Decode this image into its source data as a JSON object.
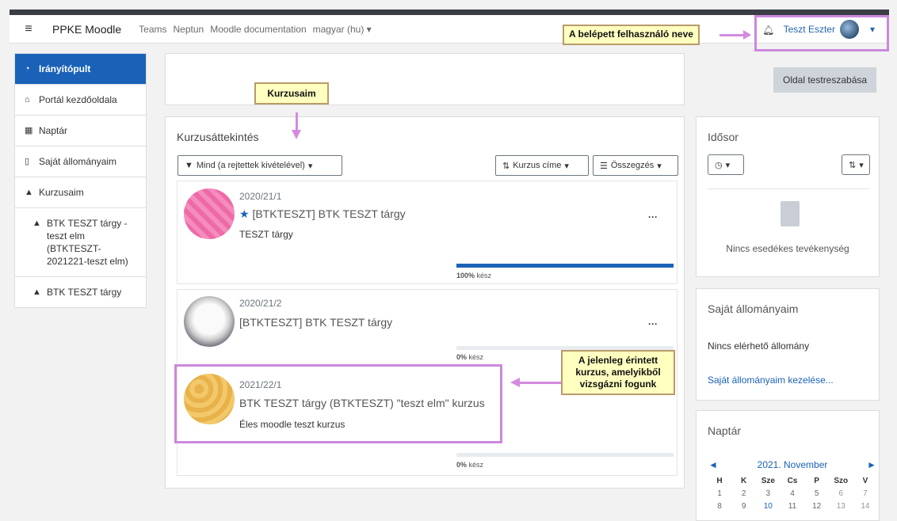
{
  "navbar": {
    "brand": "PPKE Moodle",
    "links": [
      "Teams",
      "Neptun",
      "Moodle documentation",
      "magyar (hu)"
    ],
    "user_name": "Teszt Eszter"
  },
  "sidebar": {
    "items": [
      {
        "label": "Irányítópult",
        "icon": "dashboard-icon"
      },
      {
        "label": "Portál kezdőoldala",
        "icon": "home-icon"
      },
      {
        "label": "Naptár",
        "icon": "calendar-icon"
      },
      {
        "label": "Saját állományaim",
        "icon": "file-icon"
      },
      {
        "label": "Kurzusaim",
        "icon": "graduation-cap-icon"
      },
      {
        "label": "BTK TESZT tárgy - teszt elm (BTKTESZT-2021221-teszt elm)",
        "icon": "graduation-cap-icon"
      },
      {
        "label": "BTK TESZT tárgy",
        "icon": "graduation-cap-icon"
      }
    ]
  },
  "header": {
    "customize_label": "Oldal testreszabása"
  },
  "overview": {
    "title": "Kurzusáttekintés",
    "filter_label": "Mind (a rejtettek kivételével)",
    "sort_label": "Kurzus címe",
    "view_label": "Összegzés",
    "courses": [
      {
        "date": "2020/21/1",
        "title": "[BTKTESZT] BTK TESZT tárgy",
        "subtitle": "TESZT tárgy",
        "progress": 100,
        "progress_num": "100%",
        "progress_suffix": " kész",
        "starred": true
      },
      {
        "date": "2020/21/2",
        "title": "[BTKTESZT] BTK TESZT tárgy",
        "subtitle": "",
        "progress": 0,
        "progress_num": "0%",
        "progress_suffix": " kész",
        "starred": false
      },
      {
        "date": "2021/22/1",
        "title": "BTK TESZT tárgy (BTKTESZT) \"teszt elm\" kurzus",
        "subtitle": "Éles moodle teszt kurzus",
        "progress": 0,
        "progress_num": "0%",
        "progress_suffix": " kész",
        "starred": false
      }
    ]
  },
  "timeline": {
    "title": "Idősor",
    "empty_text": "Nincs esedékes tevékenység"
  },
  "files": {
    "title": "Saját állományaim",
    "empty_text": "Nincs elérhető állomány",
    "manage_link": "Saját állományaim kezelése..."
  },
  "calendar": {
    "title": "Naptár",
    "month": "2021. November",
    "weekdays": [
      "H",
      "K",
      "Sze",
      "Cs",
      "P",
      "Szo",
      "V"
    ],
    "week1": [
      "1",
      "2",
      "3",
      "4",
      "5",
      "6",
      "7"
    ],
    "week2": [
      "8",
      "9",
      "10",
      "11",
      "12",
      "13",
      "14"
    ]
  },
  "callouts": {
    "user": "A belépett felhasználó neve",
    "courses": "Kurzusaim",
    "current": "A jelenleg érintett kurzus, amelyikből vizsgázni fogunk"
  },
  "colors": {
    "accent": "#1a62b8",
    "callout_bg": "#ffffc0",
    "highlight": "#cc88dd"
  }
}
